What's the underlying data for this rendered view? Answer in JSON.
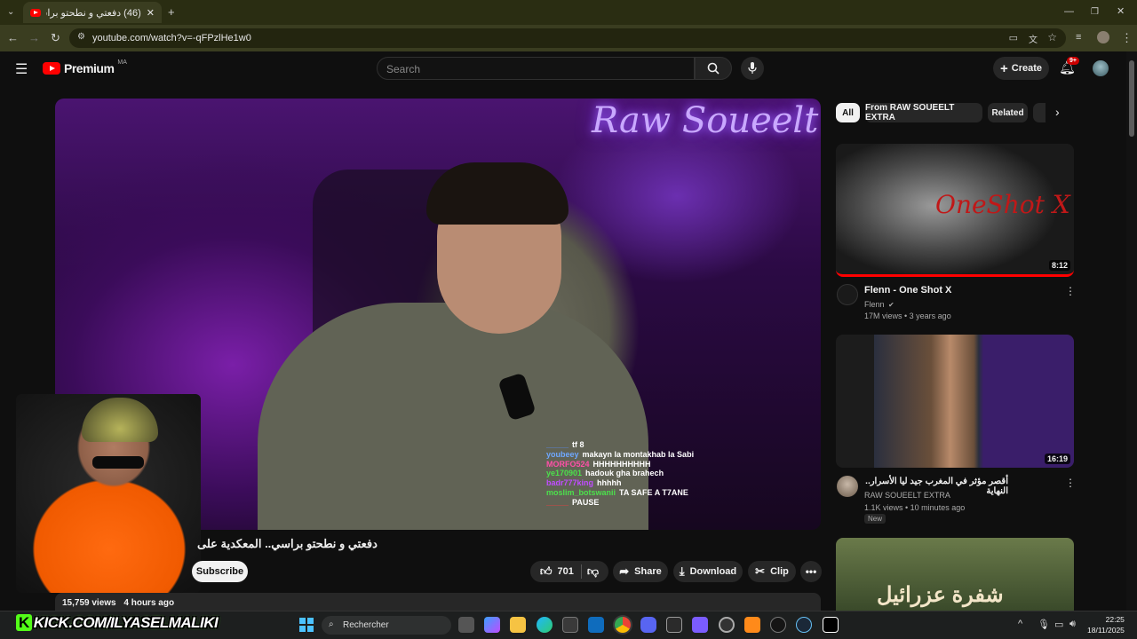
{
  "browser": {
    "tab_title": "(46) دفعتي و نطحتو براسي.. المعـ",
    "url": "youtube.com/watch?v=-qFPzlHe1w0"
  },
  "header": {
    "brand": "Premium",
    "region": "MA",
    "search_placeholder": "Search",
    "create_label": "Create",
    "notif_badge": "9+"
  },
  "video": {
    "neon_text": "Raw Soueelt",
    "title": "دفعتي و نطحتو براسي.. المعكدية على",
    "subscribe_label": "Subscribe",
    "likes": "701",
    "share_label": "Share",
    "download_label": "Download",
    "clip_label": "Clip",
    "views": "15,759 views",
    "age": "4 hours ago",
    "chat": [
      {
        "user": "_____",
        "msg": "tf 8",
        "color": "#5b8cff"
      },
      {
        "user": "youbeey",
        "msg": "makayn la montakhab la Sabi",
        "color": "#6fa8ff"
      },
      {
        "user": "MORFO524",
        "msg": "HHHHHHHHHH",
        "color": "#ff4fa8"
      },
      {
        "user": "ye170901",
        "msg": "hadouk gha brahech",
        "color": "#4ce04c"
      },
      {
        "user": "badr777king",
        "msg": "hhhhh",
        "color": "#c04cff"
      },
      {
        "user": "moslim_botswanii",
        "msg": "TA SAFE A T7ANE",
        "color": "#4ce04c"
      },
      {
        "user": "_____",
        "msg": "PAUSE",
        "color": "#ff3b3b"
      }
    ]
  },
  "chips": [
    "All",
    "From RAW SOUEELT EXTRA",
    "Related"
  ],
  "related": [
    {
      "title": "Flenn - One Shot X",
      "channel": "Flenn",
      "meta": "17M views • 3 years ago",
      "duration": "8:12",
      "thumb_text": "OneShot X"
    },
    {
      "title": "أقصر مؤثر في المغرب جيد ليا الأسرار.. النهاية",
      "channel": "RAW SOUEELT EXTRA",
      "meta": "1.1K views • 10 minutes ago",
      "badge": "New",
      "duration": "16:19"
    },
    {
      "title": "",
      "thumb_text": "شفرة عزرائيل"
    }
  ],
  "overlay": {
    "kick_label": "KICK.COM/ILYASELMALIKI"
  },
  "taskbar": {
    "search_label": "Rechercher",
    "time": "22:25",
    "date": "18/11/2025"
  },
  "colors": {
    "yt_red": "#ff0000",
    "kick_green": "#53fc18"
  }
}
